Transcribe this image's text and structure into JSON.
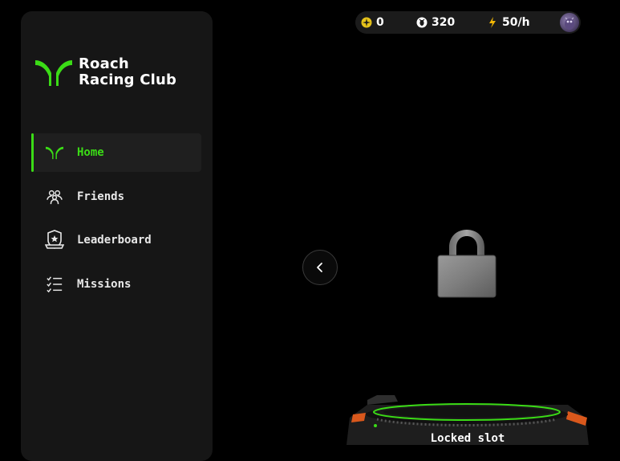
{
  "brand": {
    "name_line1": "Roach",
    "name_line2": "Racing Club",
    "accent": "#3bdc16"
  },
  "nav": {
    "items": [
      {
        "label": "Home",
        "icon": "roach-logo-icon",
        "active": true
      },
      {
        "label": "Friends",
        "icon": "friends-icon",
        "active": false
      },
      {
        "label": "Leaderboard",
        "icon": "leaderboard-badge-icon",
        "active": false
      },
      {
        "label": "Missions",
        "icon": "checklist-icon",
        "active": false
      }
    ]
  },
  "stats": {
    "token_value": "0",
    "roach_value": "320",
    "rate_value": "50/h"
  },
  "slot": {
    "status_label": "Locked slot",
    "icon": "padlock-icon"
  }
}
